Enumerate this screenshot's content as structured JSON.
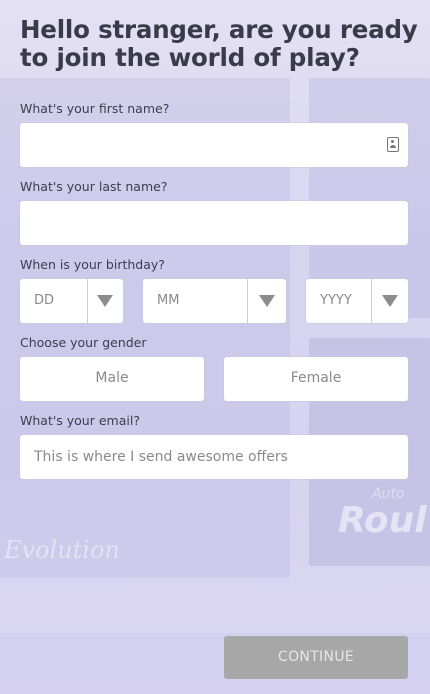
{
  "title": "Hello stranger, are you ready to join the world of play?",
  "background": {
    "brand_left": "Evolution",
    "brand_right_small": "Auto",
    "brand_right_large": "Roul"
  },
  "form": {
    "first_name": {
      "label": "What's your first name?",
      "value": "",
      "placeholder": ""
    },
    "last_name": {
      "label": "What's your last name?",
      "value": "",
      "placeholder": ""
    },
    "birthday": {
      "label": "When is your birthday?",
      "day": "DD",
      "month": "MM",
      "year": "YYYY"
    },
    "gender": {
      "label": "Choose your gender",
      "options": [
        "Male",
        "Female"
      ]
    },
    "email": {
      "label": "What's your email?",
      "value": "",
      "placeholder": "This is where I send awesome offers"
    }
  },
  "actions": {
    "continue_label": "CONTINUE"
  },
  "colors": {
    "continue_bg": "#a7a7a7",
    "field_bg": "#ffffff",
    "page_bg": "#d7d6f1"
  },
  "icons": {
    "contact": "contact-card-icon",
    "dropdown": "triangle-down-icon"
  }
}
